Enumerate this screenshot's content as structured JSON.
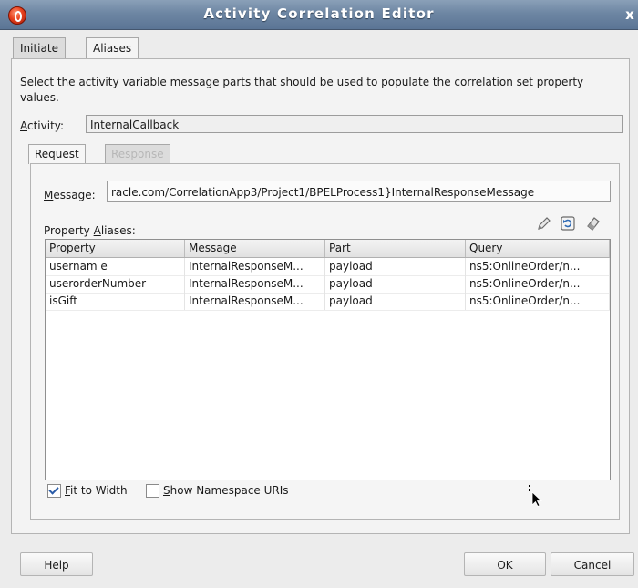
{
  "window": {
    "title": "Activity Correlation Editor",
    "close_label": "x"
  },
  "tabs_top": [
    {
      "label": "Initiate"
    },
    {
      "label": "Aliases"
    }
  ],
  "instructions": "Select the activity variable message parts that should be used to populate the correlation set property values.",
  "activity": {
    "label_hotkey": "A",
    "label_rest": "ctivity:",
    "value": "InternalCallback"
  },
  "inner_tabs": [
    {
      "label": "Request"
    },
    {
      "label": "Response"
    }
  ],
  "message": {
    "label_hotkey": "M",
    "label_rest": "essage:",
    "value": "racle.com/CorrelationApp3/Project1/BPELProcess1}InternalResponseMessage"
  },
  "aliases": {
    "label_prefix": "Property ",
    "label_hotkey": "A",
    "label_rest": "liases:"
  },
  "toolbar_icons": [
    "edit-icon",
    "refresh-icon",
    "eraser-icon"
  ],
  "table": {
    "headers": [
      "Property",
      "Message",
      "Part",
      "Query"
    ],
    "rows": [
      [
        "usernam e",
        "InternalResponseM...",
        "payload",
        "ns5:OnlineOrder/n..."
      ],
      [
        "userorderNumber",
        "InternalResponseM...",
        "payload",
        "ns5:OnlineOrder/n..."
      ],
      [
        "isGift",
        "InternalResponseM...",
        "payload",
        "ns5:OnlineOrder/n..."
      ]
    ]
  },
  "checkboxes": {
    "fit_to_width": {
      "hotkey": "F",
      "rest": "it to Width",
      "checked": true
    },
    "show_namespace": {
      "hotkey": "S",
      "rest": "how Namespace URIs",
      "checked": false
    }
  },
  "buttons": {
    "help": "Help",
    "ok": "OK",
    "cancel": "Cancel"
  },
  "colors": {
    "titlebar": "#6d86a3",
    "panel": "#f3f3f3",
    "checkmark": "#2a5ca8"
  }
}
